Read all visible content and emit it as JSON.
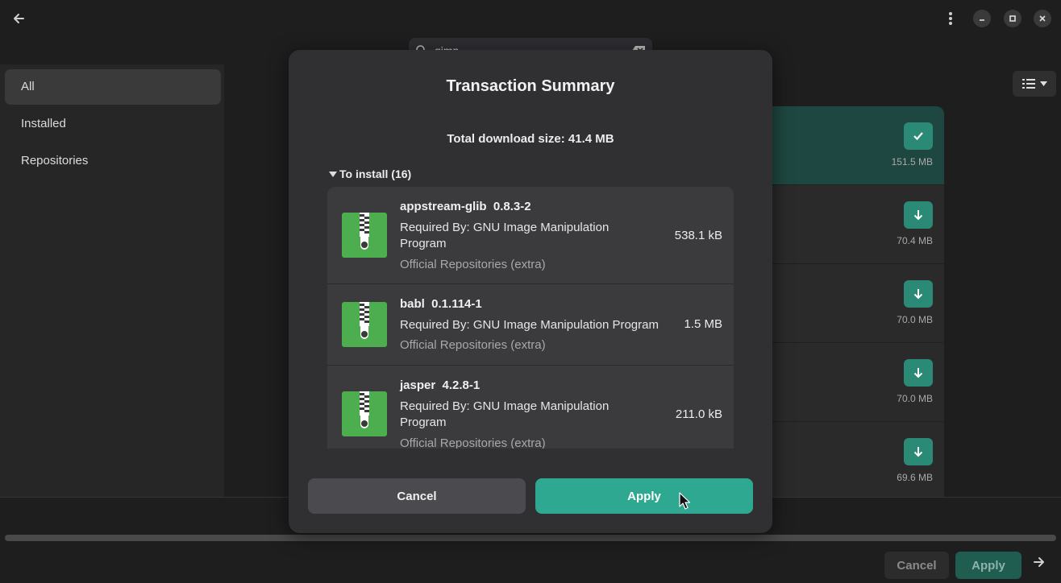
{
  "header": {
    "back_icon": "arrow-left-icon",
    "menu_icon": "kebab-menu-icon",
    "minimize_icon": "minimize-icon",
    "maximize_icon": "maximize-icon",
    "close_icon": "close-icon"
  },
  "search": {
    "value": "gimp"
  },
  "sidebar": {
    "items": [
      {
        "label": "All",
        "active": true
      },
      {
        "label": "Installed",
        "active": false
      },
      {
        "label": "Repositories",
        "active": false
      }
    ]
  },
  "package_list": {
    "rows": [
      {
        "size": "151.5 MB",
        "action": "installed-check-icon",
        "selected": true
      },
      {
        "size": "70.4 MB",
        "action": "download-icon",
        "selected": false
      },
      {
        "size": "70.0 MB",
        "action": "download-icon",
        "selected": false
      },
      {
        "size": "70.0 MB",
        "action": "download-icon",
        "selected": false
      },
      {
        "size": "69.6 MB",
        "action": "download-icon",
        "selected": false
      }
    ]
  },
  "bottom_bar": {
    "cancel_label": "Cancel",
    "apply_label": "Apply"
  },
  "dialog": {
    "title": "Transaction Summary",
    "total": "Total download size: 41.4 MB",
    "expander_label": "To install (16)",
    "packages": [
      {
        "name": "appstream-glib  0.8.3-2",
        "required_by": "Required By: GNU Image Manipulation Program",
        "repo": "Official Repositories (extra)",
        "size": "538.1 kB"
      },
      {
        "name": "babl  0.1.114-1",
        "required_by": "Required By: GNU Image Manipulation Program",
        "repo": "Official Repositories (extra)",
        "size": "1.5 MB"
      },
      {
        "name": "jasper  4.2.8-1",
        "required_by": "Required By: GNU Image Manipulation Program",
        "repo": "Official Repositories (extra)",
        "size": "211.0 kB"
      }
    ],
    "cancel_label": "Cancel",
    "apply_label": "Apply"
  },
  "colors": {
    "accent": "#2ea891",
    "archive_green": "#4cae4f",
    "dialog_bg": "#303033"
  }
}
